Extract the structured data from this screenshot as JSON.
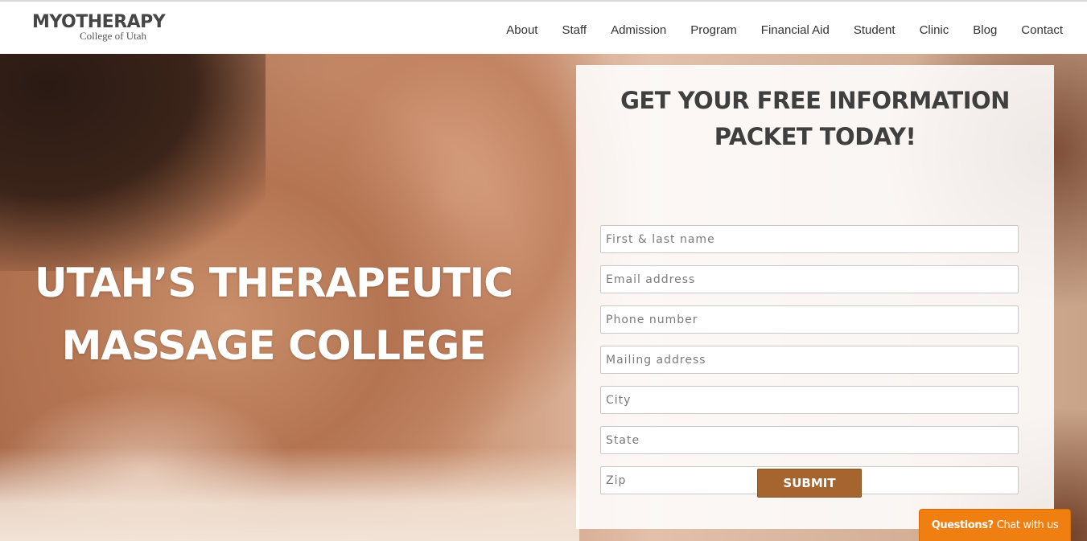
{
  "header": {
    "logo": {
      "main": "MYOTHERAPY",
      "sub": "College of Utah"
    },
    "nav": [
      {
        "label": "About"
      },
      {
        "label": "Staff"
      },
      {
        "label": "Admission"
      },
      {
        "label": "Program"
      },
      {
        "label": "Financial Aid"
      },
      {
        "label": "Student"
      },
      {
        "label": "Clinic"
      },
      {
        "label": "Blog"
      },
      {
        "label": "Contact"
      }
    ]
  },
  "hero": {
    "title": "UTAH’S THERAPEUTIC MASSAGE COLLEGE"
  },
  "form": {
    "heading": "GET YOUR FREE INFORMATION PACKET TODAY!",
    "fields": [
      {
        "placeholder": "First & last name",
        "value": ""
      },
      {
        "placeholder": "Email address",
        "value": ""
      },
      {
        "placeholder": "Phone number",
        "value": ""
      },
      {
        "placeholder": "Mailing address",
        "value": ""
      },
      {
        "placeholder": "City",
        "value": ""
      },
      {
        "placeholder": "State",
        "value": ""
      },
      {
        "placeholder": "Zip",
        "value": ""
      }
    ],
    "submit_label": "SUBMIT"
  },
  "chat": {
    "question": "Questions?",
    "action": "Chat with us"
  },
  "colors": {
    "accent_brown": "#a6642f",
    "chat_orange": "#f07f12",
    "heading_text": "#3f3f3f"
  }
}
